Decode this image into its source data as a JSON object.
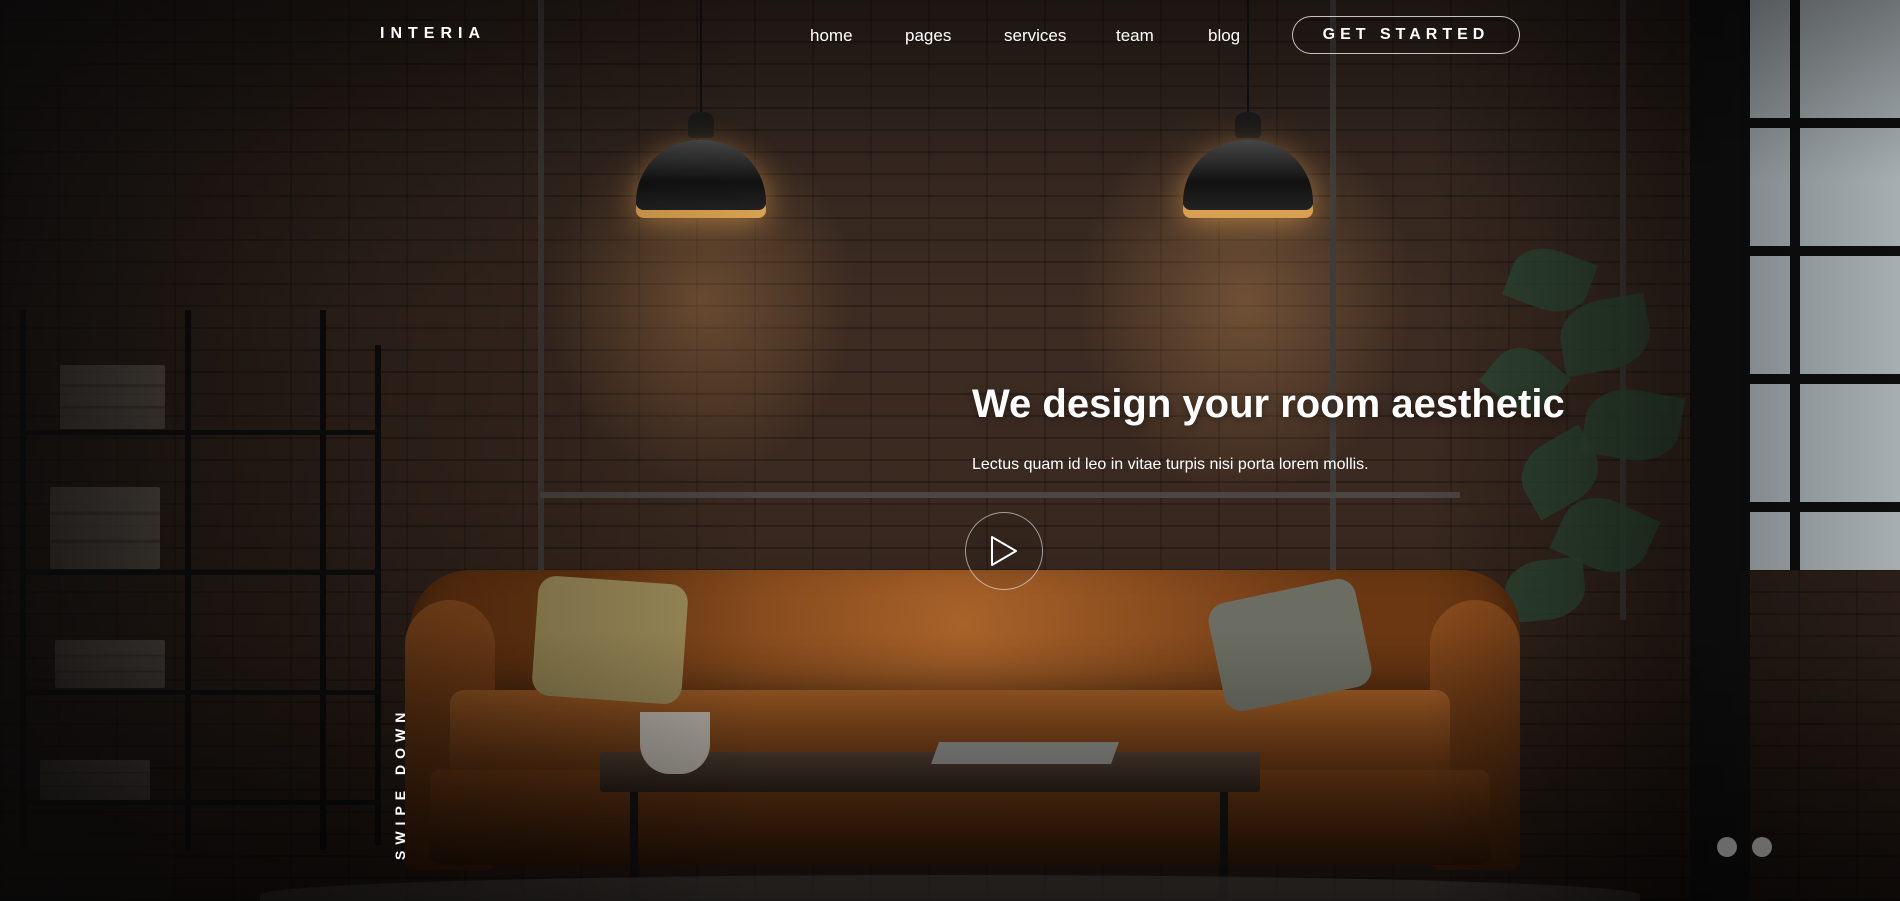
{
  "brand": {
    "logo": "INTERIA"
  },
  "nav": {
    "links": [
      "home",
      "pages",
      "services",
      "team",
      "blog"
    ],
    "cta_label": "GET STARTED"
  },
  "hero": {
    "headline": "We design your room aesthetic",
    "subtitle": "Lectus quam id leo in vitae turpis nisi porta lorem mollis.",
    "play_icon": "play-icon",
    "scroll_hint": "SWIPE DOWN"
  },
  "slider": {
    "dot_count": 2,
    "active_index": 0
  },
  "colors": {
    "text": "#ffffff",
    "accent_warm": "#d8a050",
    "dot": "#8c8c8c"
  }
}
